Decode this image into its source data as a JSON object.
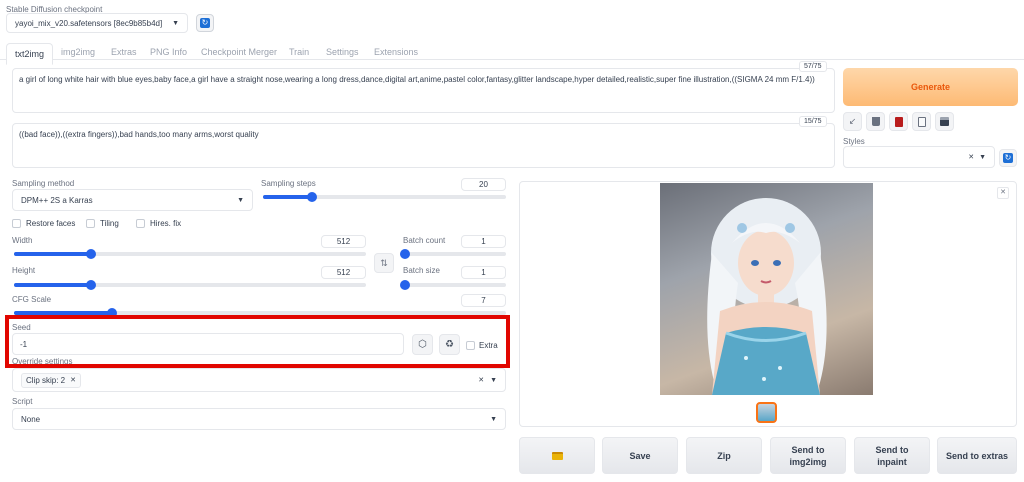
{
  "checkpoint": {
    "label": "Stable Diffusion checkpoint",
    "value": "yayoi_mix_v20.safetensors [8ec9b85b4d]"
  },
  "tabs": [
    "txt2img",
    "img2img",
    "Extras",
    "PNG Info",
    "Checkpoint Merger",
    "Train",
    "Settings",
    "Extensions"
  ],
  "prompt": {
    "text": "a girl of long white hair with blue eyes,baby face,a girl have a straight nose,wearing a long dress,dance,digital art,anime,pastel color,fantasy,glitter landscape,hyper detailed,realistic,super fine illustration,((SIGMA 24 mm F/1.4))",
    "counter": "57/75"
  },
  "negative_prompt": {
    "text": "((bad face)),((extra fingers)),bad hands,too many arms,worst quality",
    "counter": "15/75"
  },
  "generate_label": "Generate",
  "styles_label": "Styles",
  "sampling": {
    "method_label": "Sampling method",
    "method_value": "DPM++ 2S a Karras",
    "steps_label": "Sampling steps",
    "steps_value": "20",
    "steps_fraction": 0.2
  },
  "checks": {
    "restore_faces": "Restore faces",
    "tiling": "Tiling",
    "hires_fix": "Hires. fix"
  },
  "width": {
    "label": "Width",
    "value": "512",
    "fraction": 0.22
  },
  "height": {
    "label": "Height",
    "value": "512",
    "fraction": 0.22
  },
  "batch_count": {
    "label": "Batch count",
    "value": "1",
    "fraction": 0.0
  },
  "batch_size": {
    "label": "Batch size",
    "value": "1",
    "fraction": 0.0
  },
  "swap_icon": "swap-icon",
  "cfg": {
    "label": "CFG Scale",
    "value": "7",
    "fraction": 0.2
  },
  "seed": {
    "label": "Seed",
    "value": "-1",
    "extra_label": "Extra"
  },
  "override": {
    "label": "Override settings",
    "tag": "Clip skip: 2"
  },
  "script": {
    "label": "Script",
    "value": "None"
  },
  "actions": {
    "folder": "folder-icon",
    "save": "Save",
    "zip": "Zip",
    "img2img": "Send to\nimg2img",
    "inpaint": "Send to\ninpaint",
    "extras": "Send to extras"
  },
  "colors": {
    "accent": "#2563eb",
    "generate": "#f97316",
    "highlight": "#e10600"
  }
}
